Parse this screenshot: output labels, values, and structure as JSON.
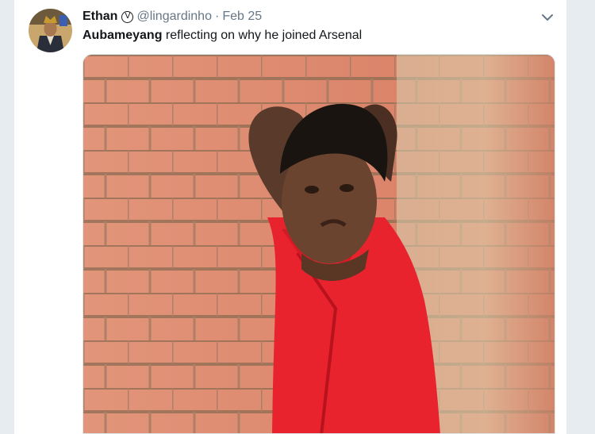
{
  "tweet": {
    "author_name": "Ethan",
    "verified_icon": "verified-badge-icon",
    "handle": "@lingardinho",
    "separator": "·",
    "date": "Feb 25",
    "text_bold": "Aubameyang",
    "text_rest": " reflecting on why he joined Arsenal",
    "menu_icon": "chevron-down-icon"
  },
  "colors": {
    "background": "#e6ecf0",
    "card": "#ffffff",
    "text_primary": "#14171a",
    "text_secondary": "#657786",
    "wall_brick": "#d9826a",
    "shirt_red": "#e8232e"
  }
}
